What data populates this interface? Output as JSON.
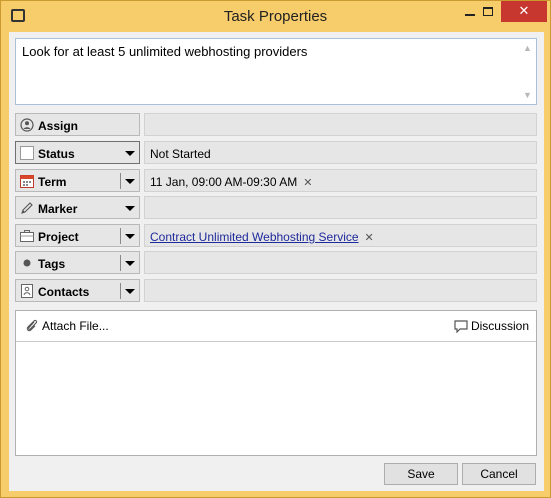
{
  "window": {
    "title": "Task Properties",
    "close_glyph": "✕",
    "accent": "#f7cd6c"
  },
  "task": {
    "text": "Look for at least 5 unlimited webhosting providers"
  },
  "fields": {
    "assign": {
      "label": "Assign",
      "icon": "person-icon",
      "value": ""
    },
    "status": {
      "label": "Status",
      "icon": "status-box-icon",
      "value": "Not Started"
    },
    "term": {
      "label": "Term",
      "icon": "calendar-icon",
      "value": "11 Jan, 09:00 AM-09:30 AM"
    },
    "marker": {
      "label": "Marker",
      "icon": "pencil-icon",
      "value": ""
    },
    "project": {
      "label": "Project",
      "icon": "briefcase-icon",
      "value": "Contract Unlimited Webhosting Service"
    },
    "tags": {
      "label": "Tags",
      "icon": "dot-icon",
      "value": ""
    },
    "contacts": {
      "label": "Contacts",
      "icon": "contact-card-icon",
      "value": ""
    }
  },
  "remove_glyph": "✕",
  "attachments": {
    "attach_label": "Attach File...",
    "discussion_label": "Discussion"
  },
  "footer": {
    "save_label": "Save",
    "cancel_label": "Cancel"
  }
}
